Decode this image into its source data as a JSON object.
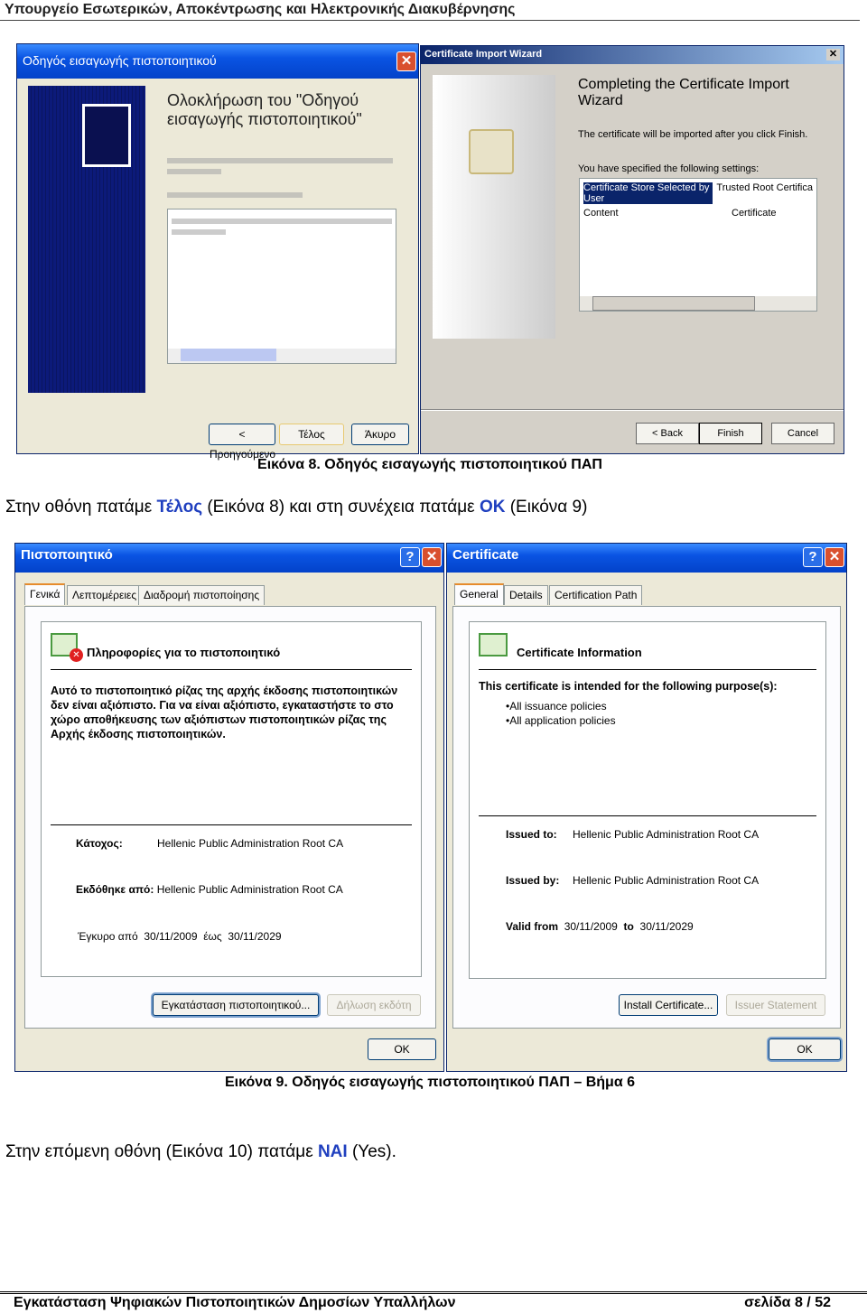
{
  "header": {
    "title": "Υπουργείο Εσωτερικών, Αποκέντρωσης και Ηλεκτρονικής Διακυβέρνησης"
  },
  "figure8": {
    "greek_wizard": {
      "title": "Οδηγός εισαγωγής πιστοποιητικού",
      "heading": "Ολοκλήρωση του \"Οδηγού εισαγωγής πιστοποιητικού\"",
      "back": "< Προηγούμενο",
      "finish": "Τέλος",
      "cancel": "Άκυρο"
    },
    "english_wizard": {
      "title": "Certificate Import Wizard",
      "heading": "Completing the Certificate Import Wizard",
      "note": "The certificate will be imported after you click Finish.",
      "settings_label": "You have specified the following settings:",
      "rows": [
        [
          "Certificate Store Selected by User",
          "Trusted Root Certifica"
        ],
        [
          "Content",
          "Certificate"
        ]
      ],
      "back": "< Back",
      "finish": "Finish",
      "cancel": "Cancel"
    },
    "caption": "Εικόνα 8. Οδηγός εισαγωγής πιστοποιητικού ΠΑΠ"
  },
  "para1": {
    "a": "Στην οθόνη πατάμε ",
    "b": "Τέλος",
    "c": " (Εικόνα 8) και στη συνέχεια πατάμε ",
    "d": "OK",
    "e": " (Εικόνα 9)"
  },
  "figure9": {
    "greek": {
      "title": "Πιστοποιητικό",
      "tabs": [
        "Γενικά",
        "Λεπτομέρειες",
        "Διαδρομή πιστοποίησης"
      ],
      "info_title": "Πληροφορίες για το πιστοποιητικό",
      "warning": "Αυτό το πιστοποιητικό ρίζας της αρχής έκδοσης πιστοποιητικών δεν είναι αξιόπιστο. Για να είναι αξιόπιστο, εγκαταστήστε το στο χώρο αποθήκευσης των αξιόπιστων πιστοποιητικών ρίζας της Αρχής έκδοσης πιστοποιητικών.",
      "issued_to_label": "Κάτοχος:",
      "issued_to": "Hellenic Public Administration Root CA",
      "issued_by_label": "Εκδόθηκε από:",
      "issued_by": "Hellenic Public Administration Root CA",
      "valid": "Έγκυρο από  30/11/2009  έως  30/11/2029",
      "install": "Εγκατάσταση πιστοποιητικού...",
      "statement": "Δήλωση εκδότη",
      "ok": "OK"
    },
    "english": {
      "title": "Certificate",
      "tabs": [
        "General",
        "Details",
        "Certification Path"
      ],
      "info_title": "Certificate Information",
      "purpose": "This certificate is intended for the following purpose(s):",
      "purposes": [
        "•All issuance policies",
        "•All application policies"
      ],
      "issued_to_label": "Issued to:",
      "issued_to": "Hellenic Public Administration Root CA",
      "issued_by_label": "Issued by:",
      "issued_by": "Hellenic Public Administration Root CA",
      "valid_from_label": "Valid from",
      "valid_from": "30/11/2009",
      "to_label": "to",
      "valid_to": "30/11/2029",
      "install": "Install Certificate...",
      "statement": "Issuer Statement",
      "ok": "OK"
    },
    "caption": "Εικόνα 9. Οδηγός εισαγωγής πιστοποιητικού ΠΑΠ – Βήμα 6"
  },
  "para2": {
    "a": "Στην επόμενη οθόνη (Εικόνα 10) πατάμε ",
    "b": "ΝΑΙ",
    "c": " (Yes)."
  },
  "footer": {
    "left": "Εγκατάσταση Ψηφιακών Πιστοποιητικών Δημοσίων Υπαλλήλων",
    "right": "σελίδα 8 / 52"
  }
}
